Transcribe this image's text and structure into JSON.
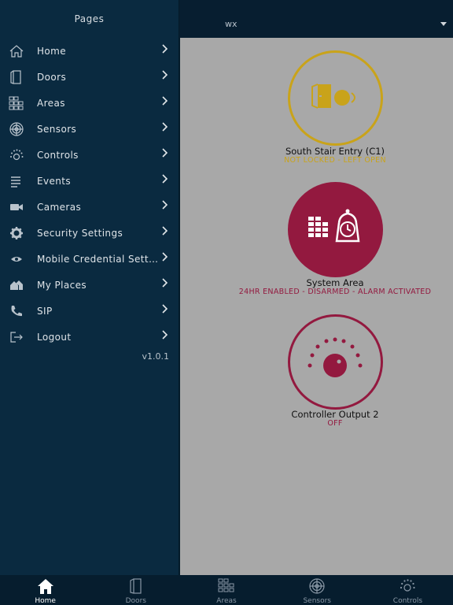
{
  "sidebar": {
    "title": "Pages",
    "version": "v1.0.1",
    "items": [
      {
        "label": "Home",
        "icon": "home-icon"
      },
      {
        "label": "Doors",
        "icon": "door-icon"
      },
      {
        "label": "Areas",
        "icon": "grid-icon"
      },
      {
        "label": "Sensors",
        "icon": "sensor-icon"
      },
      {
        "label": "Controls",
        "icon": "dial-icon"
      },
      {
        "label": "Events",
        "icon": "list-icon"
      },
      {
        "label": "Cameras",
        "icon": "camera-icon"
      },
      {
        "label": "Security Settings",
        "icon": "gear-icon"
      },
      {
        "label": "Mobile Credential Setti...",
        "icon": "eye-icon"
      },
      {
        "label": "My Places",
        "icon": "houses-icon"
      },
      {
        "label": "SIP",
        "icon": "phone-icon"
      },
      {
        "label": "Logout",
        "icon": "logout-icon"
      }
    ]
  },
  "topbar": {
    "title": "wx"
  },
  "cards": [
    {
      "name": "South Stair Entry (C1)",
      "status": "NOT LOCKED - LEFT OPEN",
      "color": "#c9a31a"
    },
    {
      "name": "System Area",
      "status": "24HR ENABLED - DISARMED - ALARM ACTIVATED",
      "color": "#93193f"
    },
    {
      "name": "Controller Output 2",
      "status": "OFF",
      "color": "#93193f"
    }
  ],
  "bottomnav": {
    "tabs": [
      {
        "label": "Home",
        "icon": "home-icon",
        "active": true
      },
      {
        "label": "Doors",
        "icon": "door-icon",
        "active": false
      },
      {
        "label": "Areas",
        "icon": "grid-icon",
        "active": false
      },
      {
        "label": "Sensors",
        "icon": "sensor-icon",
        "active": false
      },
      {
        "label": "Controls",
        "icon": "dial-icon",
        "active": false
      }
    ]
  },
  "colors": {
    "sidebar_bg": "#0a2a40",
    "main_bg": "#a8a8a8",
    "door_accent": "#c9a31a",
    "alarm_accent": "#93193f"
  }
}
